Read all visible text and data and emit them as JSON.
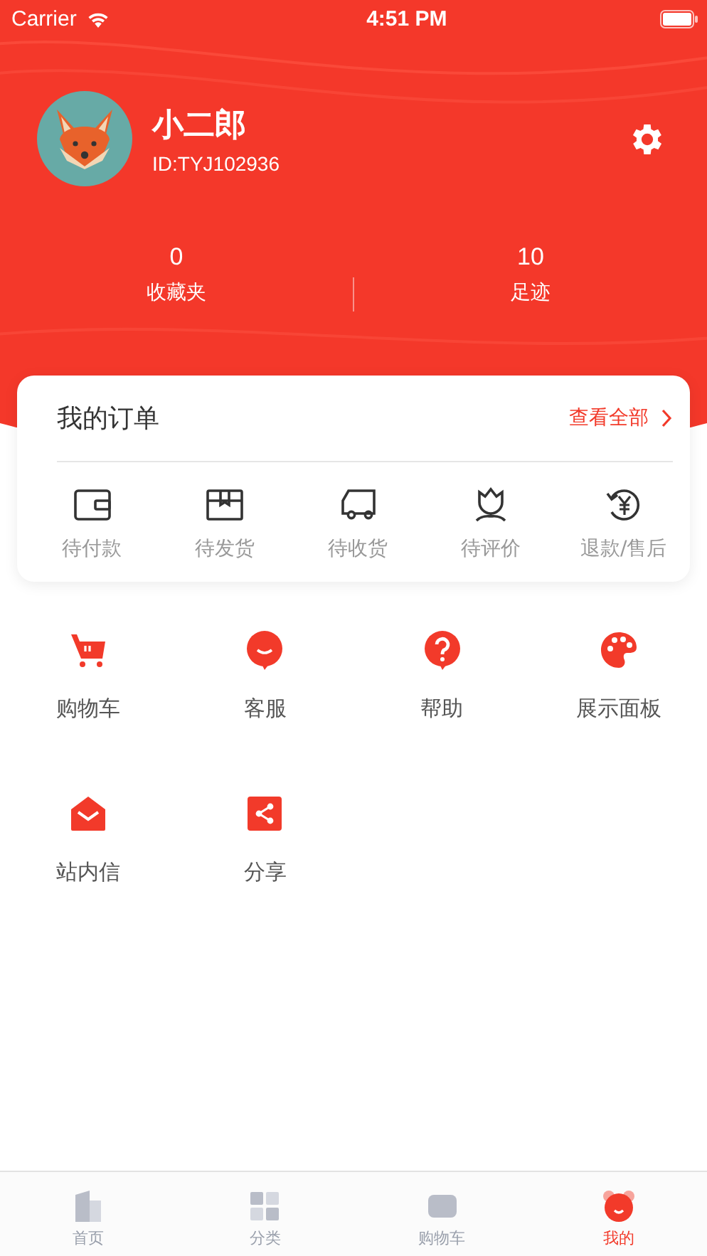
{
  "status_bar": {
    "carrier": "Carrier",
    "time": "4:51 PM"
  },
  "profile": {
    "name": "小二郎",
    "id": "ID:TYJ102936"
  },
  "stats": [
    {
      "value": "0",
      "label": "收藏夹"
    },
    {
      "value": "10",
      "label": "足迹"
    }
  ],
  "orders": {
    "title": "我的订单",
    "view_all": "查看全部",
    "items": [
      "待付款",
      "待发货",
      "待收货",
      "待评价",
      "退款/售后"
    ]
  },
  "menu": [
    "购物车",
    "客服",
    "帮助",
    "展示面板",
    "站内信",
    "分享"
  ],
  "tab_bar": [
    {
      "label": "首页",
      "selected": false
    },
    {
      "label": "分类",
      "selected": false
    },
    {
      "label": "购物车",
      "selected": false
    },
    {
      "label": "我的",
      "selected": true
    }
  ]
}
